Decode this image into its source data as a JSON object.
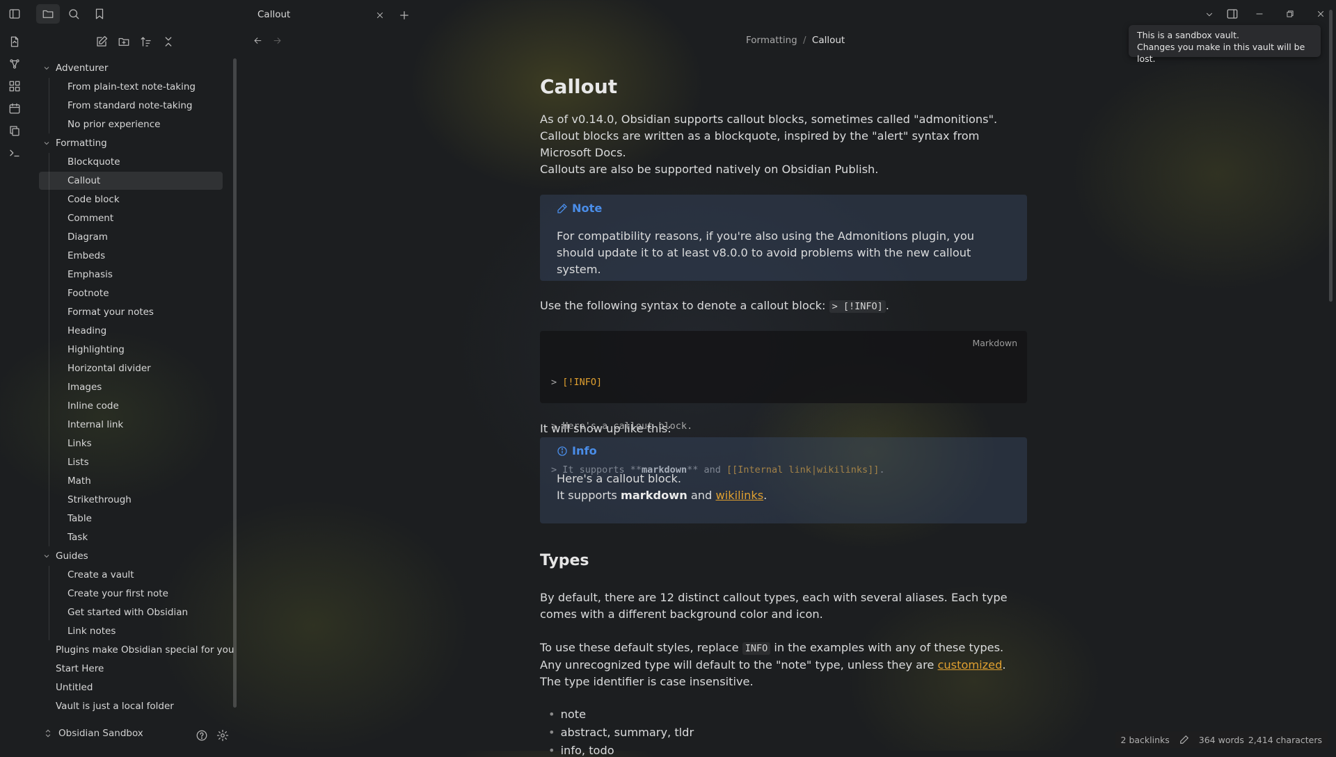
{
  "colors": {
    "accent": "#4a8de8",
    "link": "#e0a030",
    "code_highlight": "#e0a030"
  },
  "ribbon": {
    "icons": [
      "sidebar-toggle-icon",
      "file-open-icon",
      "graph-icon",
      "canvas-icon",
      "calendar-icon",
      "copy-icon",
      "terminal-icon"
    ]
  },
  "sidebar": {
    "toolbar_icons": [
      "folder-icon",
      "search-icon",
      "bookmark-icon"
    ],
    "actions": [
      "new-note-icon",
      "new-folder-icon",
      "sort-icon",
      "collapse-icon"
    ],
    "tree": [
      {
        "label": "Adventurer",
        "type": "folder"
      },
      {
        "label": "From plain-text note-taking",
        "type": "file"
      },
      {
        "label": "From standard note-taking",
        "type": "file"
      },
      {
        "label": "No prior experience",
        "type": "file"
      },
      {
        "label": "Formatting",
        "type": "folder"
      },
      {
        "label": "Blockquote",
        "type": "file"
      },
      {
        "label": "Callout",
        "type": "file",
        "active": true
      },
      {
        "label": "Code block",
        "type": "file"
      },
      {
        "label": "Comment",
        "type": "file"
      },
      {
        "label": "Diagram",
        "type": "file"
      },
      {
        "label": "Embeds",
        "type": "file"
      },
      {
        "label": "Emphasis",
        "type": "file"
      },
      {
        "label": "Footnote",
        "type": "file"
      },
      {
        "label": "Format your notes",
        "type": "file"
      },
      {
        "label": "Heading",
        "type": "file"
      },
      {
        "label": "Highlighting",
        "type": "file"
      },
      {
        "label": "Horizontal divider",
        "type": "file"
      },
      {
        "label": "Images",
        "type": "file"
      },
      {
        "label": "Inline code",
        "type": "file"
      },
      {
        "label": "Internal link",
        "type": "file"
      },
      {
        "label": "Links",
        "type": "file"
      },
      {
        "label": "Lists",
        "type": "file"
      },
      {
        "label": "Math",
        "type": "file"
      },
      {
        "label": "Strikethrough",
        "type": "file"
      },
      {
        "label": "Table",
        "type": "file"
      },
      {
        "label": "Task",
        "type": "file"
      },
      {
        "label": "Guides",
        "type": "folder"
      },
      {
        "label": "Create a vault",
        "type": "file"
      },
      {
        "label": "Create your first note",
        "type": "file"
      },
      {
        "label": "Get started with Obsidian",
        "type": "file"
      },
      {
        "label": "Link notes",
        "type": "file"
      },
      {
        "label": "Plugins make Obsidian special for you",
        "type": "root"
      },
      {
        "label": "Start Here",
        "type": "root"
      },
      {
        "label": "Untitled",
        "type": "root"
      },
      {
        "label": "Vault is just a local folder",
        "type": "root"
      }
    ],
    "vault_name": "Obsidian Sandbox"
  },
  "tab": {
    "title": "Callout"
  },
  "breadcrumb": {
    "folder": "Formatting",
    "separator": "/",
    "file": "Callout"
  },
  "tooltip": {
    "line1": "This is a sandbox vault.",
    "line2": "Changes you make in this vault will be lost."
  },
  "note": {
    "title": "Callout",
    "intro": "As of v0.14.0, Obsidian supports callout blocks, sometimes called \"admonitions\". Callout blocks are written as a blockquote, inspired by the \"alert\" syntax from Microsoft Docs.",
    "publish": "Callouts are also be supported natively on Obsidian Publish.",
    "note_callout": {
      "title": "Note",
      "body": "For compatibility reasons, if you're also using the Admonitions plugin, you should update it to at least v8.0.0 to avoid problems with the new callout system."
    },
    "syntax_text": "Use the following syntax to denote a callout block:",
    "syntax_code": "> [!INFO]",
    "syntax_end": ".",
    "code": {
      "lang": "Markdown",
      "line1_prefix": "> ",
      "line1_tag": "[!INFO]",
      "line2": "> Here's a callout block.",
      "line3_prefix": "> It supports **",
      "line3_bold": "markdown",
      "line3_mid": "** and ",
      "line3_link": "[[Internal link|wikilinks]]",
      "line3_end": "."
    },
    "show_text": "It will show up like this:",
    "info_callout": {
      "title": "Info",
      "line1": "Here's a callout block.",
      "line2_prefix": "It supports ",
      "line2_bold": "markdown",
      "line2_mid": " and ",
      "line2_link": "wikilinks",
      "line2_end": "."
    },
    "types_heading": "Types",
    "types_p1": "By default, there are 12 distinct callout types, each with several aliases. Each type comes with a different background color and icon.",
    "types_p2_a": "To use these default styles, replace ",
    "types_p2_code": "INFO",
    "types_p2_b": " in the examples with any of these types. Any unrecognized type will default to the \"note\" type, unless they are ",
    "types_p2_link": "customized",
    "types_p2_c": ". The type identifier is case insensitive.",
    "list": [
      "note",
      "abstract, summary, tldr",
      "info, todo"
    ]
  },
  "status": {
    "backlinks": "2 backlinks",
    "words": "364 words",
    "chars": "2,414 characters"
  }
}
